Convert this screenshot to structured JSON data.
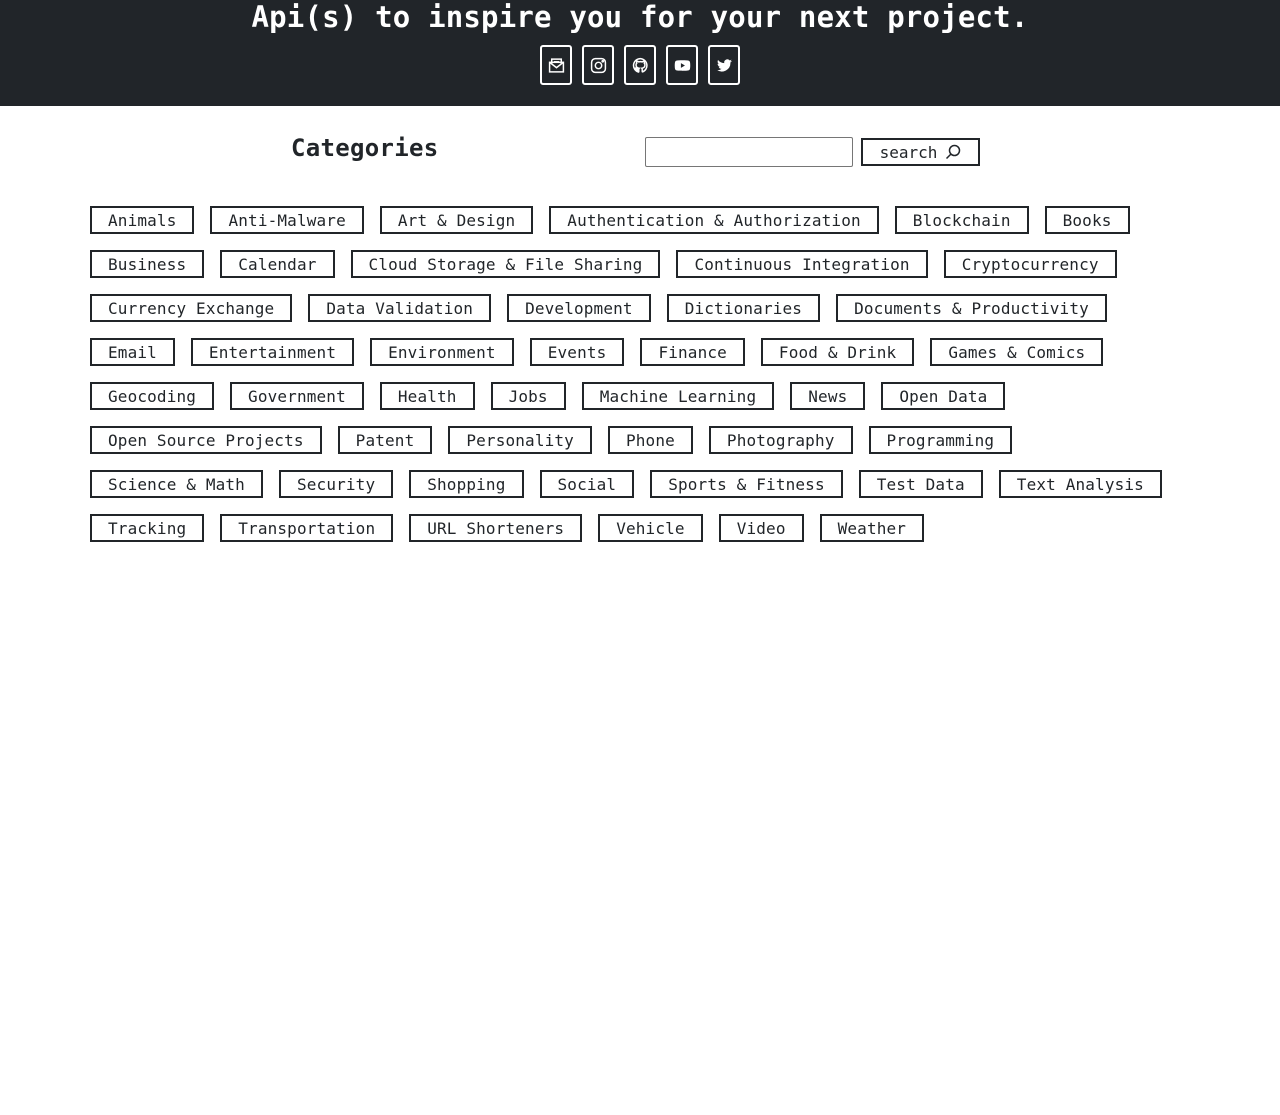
{
  "hero": {
    "title": "Api(s) to inspire you for your next project.",
    "social": [
      {
        "name": "email-icon"
      },
      {
        "name": "instagram-icon"
      },
      {
        "name": "github-icon"
      },
      {
        "name": "youtube-icon"
      },
      {
        "name": "twitter-icon"
      }
    ]
  },
  "categories_heading": "Categories",
  "search": {
    "value": "",
    "placeholder": "",
    "button_label": "search",
    "button_icon": "search-icon"
  },
  "colors": {
    "header_bg": "#212529",
    "text": "#212529",
    "background": "#ffffff"
  },
  "categories": [
    "Animals",
    "Anti-Malware",
    "Art & Design",
    "Authentication & Authorization",
    "Blockchain",
    "Books",
    "Business",
    "Calendar",
    "Cloud Storage & File Sharing",
    "Continuous Integration",
    "Cryptocurrency",
    "Currency Exchange",
    "Data Validation",
    "Development",
    "Dictionaries",
    "Documents & Productivity",
    "Email",
    "Entertainment",
    "Environment",
    "Events",
    "Finance",
    "Food & Drink",
    "Games & Comics",
    "Geocoding",
    "Government",
    "Health",
    "Jobs",
    "Machine Learning",
    "News",
    "Open Data",
    "Open Source Projects",
    "Patent",
    "Personality",
    "Phone",
    "Photography",
    "Programming",
    "Science & Math",
    "Security",
    "Shopping",
    "Social",
    "Sports & Fitness",
    "Test Data",
    "Text Analysis",
    "Tracking",
    "Transportation",
    "URL Shorteners",
    "Vehicle",
    "Video",
    "Weather"
  ]
}
